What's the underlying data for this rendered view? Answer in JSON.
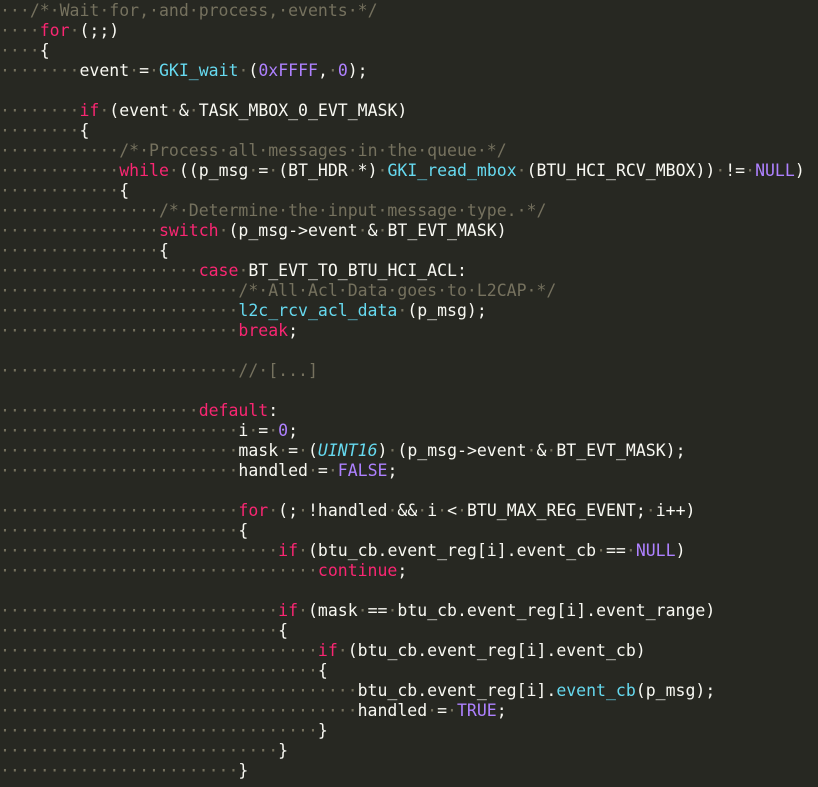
{
  "editor": {
    "language": "C",
    "colors": {
      "background": "#272822",
      "text": "#f8f8f2",
      "comment": "#75715e",
      "keyword": "#f92672",
      "function": "#66d9ef",
      "constant": "#ae81ff"
    },
    "lines": [
      [
        [
          "ws",
          "···"
        ],
        [
          "cm",
          "/*·Wait·for,·and·process,·events·*/"
        ]
      ],
      [
        [
          "ws",
          "····"
        ],
        [
          "kw",
          "for"
        ],
        [
          "ws",
          "·"
        ],
        [
          "op",
          "(;;)"
        ]
      ],
      [
        [
          "ws",
          "····"
        ],
        [
          "op",
          "{"
        ]
      ],
      [
        [
          "ws",
          "········"
        ],
        [
          "op",
          "event"
        ],
        [
          "ws",
          "·"
        ],
        [
          "op",
          "="
        ],
        [
          "ws",
          "·"
        ],
        [
          "fn",
          "GKI_wait"
        ],
        [
          "ws",
          "·"
        ],
        [
          "op",
          "("
        ],
        [
          "cs",
          "0xFFFF"
        ],
        [
          "op",
          ","
        ],
        [
          "ws",
          "·"
        ],
        [
          "cs",
          "0"
        ],
        [
          "op",
          ");"
        ]
      ],
      [],
      [
        [
          "ws",
          "········"
        ],
        [
          "kw",
          "if"
        ],
        [
          "ws",
          "·"
        ],
        [
          "op",
          "(event"
        ],
        [
          "ws",
          "·"
        ],
        [
          "op",
          "&"
        ],
        [
          "ws",
          "·"
        ],
        [
          "op",
          "TASK_MBOX_0_EVT_MASK)"
        ]
      ],
      [
        [
          "ws",
          "········"
        ],
        [
          "op",
          "{"
        ]
      ],
      [
        [
          "ws",
          "············"
        ],
        [
          "cm",
          "/*·Process·all·messages·in·the·queue·*/"
        ]
      ],
      [
        [
          "ws",
          "············"
        ],
        [
          "kw",
          "while"
        ],
        [
          "ws",
          "·"
        ],
        [
          "op",
          "((p_msg"
        ],
        [
          "ws",
          "·"
        ],
        [
          "op",
          "="
        ],
        [
          "ws",
          "·"
        ],
        [
          "op",
          "(BT_HDR"
        ],
        [
          "ws",
          "·"
        ],
        [
          "op",
          "*)"
        ],
        [
          "ws",
          "·"
        ],
        [
          "fn",
          "GKI_read_mbox"
        ],
        [
          "ws",
          "·"
        ],
        [
          "op",
          "(BTU_HCI_RCV_MBOX))"
        ],
        [
          "ws",
          "·"
        ],
        [
          "op",
          "!="
        ],
        [
          "ws",
          "·"
        ],
        [
          "cs",
          "NULL"
        ],
        [
          "op",
          ")"
        ]
      ],
      [
        [
          "ws",
          "············"
        ],
        [
          "op",
          "{"
        ]
      ],
      [
        [
          "ws",
          "················"
        ],
        [
          "cm",
          "/*·Determine·the·input·message·type.·*/"
        ]
      ],
      [
        [
          "ws",
          "················"
        ],
        [
          "kw",
          "switch"
        ],
        [
          "ws",
          "·"
        ],
        [
          "op",
          "(p_msg->event"
        ],
        [
          "ws",
          "·"
        ],
        [
          "op",
          "&"
        ],
        [
          "ws",
          "·"
        ],
        [
          "op",
          "BT_EVT_MASK)"
        ]
      ],
      [
        [
          "ws",
          "················"
        ],
        [
          "op",
          "{"
        ]
      ],
      [
        [
          "ws",
          "····················"
        ],
        [
          "kw",
          "case"
        ],
        [
          "ws",
          "·"
        ],
        [
          "op",
          "BT_EVT_TO_BTU_HCI_ACL:"
        ]
      ],
      [
        [
          "ws",
          "························"
        ],
        [
          "cm",
          "/*·All·Acl·Data·goes·to·L2CAP·*/"
        ]
      ],
      [
        [
          "ws",
          "························"
        ],
        [
          "fn",
          "l2c_rcv_acl_data"
        ],
        [
          "ws",
          "·"
        ],
        [
          "op",
          "(p_msg);"
        ]
      ],
      [
        [
          "ws",
          "························"
        ],
        [
          "kw",
          "break"
        ],
        [
          "op",
          ";"
        ]
      ],
      [],
      [
        [
          "ws",
          "························"
        ],
        [
          "cm",
          "//·[...]"
        ]
      ],
      [],
      [
        [
          "ws",
          "····················"
        ],
        [
          "kw",
          "default"
        ],
        [
          "op",
          ":"
        ]
      ],
      [
        [
          "ws",
          "························"
        ],
        [
          "op",
          "i"
        ],
        [
          "ws",
          "·"
        ],
        [
          "op",
          "="
        ],
        [
          "ws",
          "·"
        ],
        [
          "cs",
          "0"
        ],
        [
          "op",
          ";"
        ]
      ],
      [
        [
          "ws",
          "························"
        ],
        [
          "op",
          "mask"
        ],
        [
          "ws",
          "·"
        ],
        [
          "op",
          "="
        ],
        [
          "ws",
          "·"
        ],
        [
          "op",
          "("
        ],
        [
          "ty",
          "UINT16"
        ],
        [
          "op",
          ")"
        ],
        [
          "ws",
          "·"
        ],
        [
          "op",
          "(p_msg->event"
        ],
        [
          "ws",
          "·"
        ],
        [
          "op",
          "&"
        ],
        [
          "ws",
          "·"
        ],
        [
          "op",
          "BT_EVT_MASK);"
        ]
      ],
      [
        [
          "ws",
          "························"
        ],
        [
          "op",
          "handled"
        ],
        [
          "ws",
          "·"
        ],
        [
          "op",
          "="
        ],
        [
          "ws",
          "·"
        ],
        [
          "cs",
          "FALSE"
        ],
        [
          "op",
          ";"
        ]
      ],
      [],
      [
        [
          "ws",
          "························"
        ],
        [
          "kw",
          "for"
        ],
        [
          "ws",
          "·"
        ],
        [
          "op",
          "(;"
        ],
        [
          "ws",
          "·"
        ],
        [
          "op",
          "!handled"
        ],
        [
          "ws",
          "·"
        ],
        [
          "op",
          "&&"
        ],
        [
          "ws",
          "·"
        ],
        [
          "op",
          "i"
        ],
        [
          "ws",
          "·"
        ],
        [
          "op",
          "<"
        ],
        [
          "ws",
          "·"
        ],
        [
          "op",
          "BTU_MAX_REG_EVENT;"
        ],
        [
          "ws",
          "·"
        ],
        [
          "op",
          "i++)"
        ]
      ],
      [
        [
          "ws",
          "························"
        ],
        [
          "op",
          "{"
        ]
      ],
      [
        [
          "ws",
          "····························"
        ],
        [
          "kw",
          "if"
        ],
        [
          "ws",
          "·"
        ],
        [
          "op",
          "(btu_cb.event_reg[i].event_cb"
        ],
        [
          "ws",
          "·"
        ],
        [
          "op",
          "=="
        ],
        [
          "ws",
          "·"
        ],
        [
          "cs",
          "NULL"
        ],
        [
          "op",
          ")"
        ]
      ],
      [
        [
          "ws",
          "································"
        ],
        [
          "kw",
          "continue"
        ],
        [
          "op",
          ";"
        ]
      ],
      [],
      [
        [
          "ws",
          "····························"
        ],
        [
          "kw",
          "if"
        ],
        [
          "ws",
          "·"
        ],
        [
          "op",
          "(mask"
        ],
        [
          "ws",
          "·"
        ],
        [
          "op",
          "=="
        ],
        [
          "ws",
          "·"
        ],
        [
          "op",
          "btu_cb.event_reg[i].event_range)"
        ]
      ],
      [
        [
          "ws",
          "····························"
        ],
        [
          "op",
          "{"
        ]
      ],
      [
        [
          "ws",
          "································"
        ],
        [
          "kw",
          "if"
        ],
        [
          "ws",
          "·"
        ],
        [
          "op",
          "(btu_cb.event_reg[i].event_cb)"
        ]
      ],
      [
        [
          "ws",
          "································"
        ],
        [
          "op",
          "{"
        ]
      ],
      [
        [
          "ws",
          "····································"
        ],
        [
          "op",
          "btu_cb.event_reg[i]."
        ],
        [
          "fn",
          "event_cb"
        ],
        [
          "op",
          "(p_msg);"
        ]
      ],
      [
        [
          "ws",
          "····································"
        ],
        [
          "op",
          "handled"
        ],
        [
          "ws",
          "·"
        ],
        [
          "op",
          "="
        ],
        [
          "ws",
          "·"
        ],
        [
          "cs",
          "TRUE"
        ],
        [
          "op",
          ";"
        ]
      ],
      [
        [
          "ws",
          "································"
        ],
        [
          "op",
          "}"
        ]
      ],
      [
        [
          "ws",
          "····························"
        ],
        [
          "op",
          "}"
        ]
      ],
      [
        [
          "ws",
          "························"
        ],
        [
          "op",
          "}"
        ]
      ]
    ]
  }
}
